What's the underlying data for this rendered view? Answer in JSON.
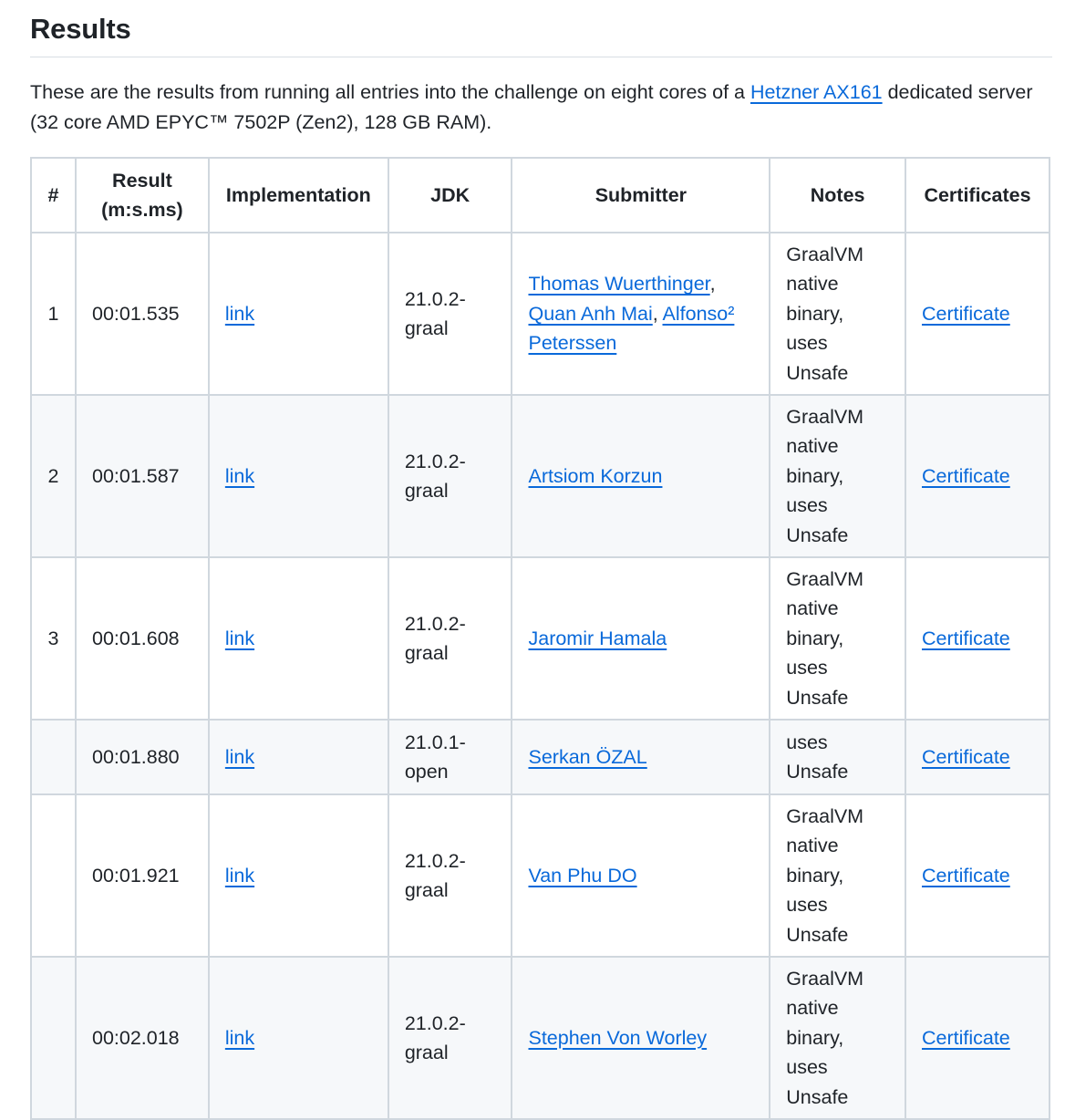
{
  "heading": "Results",
  "intro": {
    "before": "These are the results from running all entries into the challenge on eight cores of a ",
    "link": "Hetzner AX161",
    "after": " dedicated server (32 core AMD EPYC™ 7502P (Zen2), 128 GB RAM)."
  },
  "table": {
    "headers": [
      "#",
      "Result (m:s.ms)",
      "Implementation",
      "JDK",
      "Submitter",
      "Notes",
      "Certificates"
    ],
    "rows": [
      {
        "rank": "1",
        "result": "00:01.535",
        "impl": "link",
        "jdk": "21.0.2-graal",
        "submitters": [
          "Thomas Wuerthinger",
          "Quan Anh Mai",
          "Alfonso² Peterssen"
        ],
        "notes": "GraalVM native binary, uses Unsafe",
        "cert": "Certificate"
      },
      {
        "rank": "2",
        "result": "00:01.587",
        "impl": "link",
        "jdk": "21.0.2-graal",
        "submitters": [
          "Artsiom Korzun"
        ],
        "notes": "GraalVM native binary, uses Unsafe",
        "cert": "Certificate"
      },
      {
        "rank": "3",
        "result": "00:01.608",
        "impl": "link",
        "jdk": "21.0.2-graal",
        "submitters": [
          "Jaromir Hamala"
        ],
        "notes": "GraalVM native binary, uses Unsafe",
        "cert": "Certificate"
      },
      {
        "rank": "",
        "result": "00:01.880",
        "impl": "link",
        "jdk": "21.0.1-open",
        "submitters": [
          "Serkan ÖZAL"
        ],
        "notes": "uses Unsafe",
        "cert": "Certificate"
      },
      {
        "rank": "",
        "result": "00:01.921",
        "impl": "link",
        "jdk": "21.0.2-graal",
        "submitters": [
          "Van Phu DO"
        ],
        "notes": "GraalVM native binary, uses Unsafe",
        "cert": "Certificate"
      },
      {
        "rank": "",
        "result": "00:02.018",
        "impl": "link",
        "jdk": "21.0.2-graal",
        "submitters": [
          "Stephen Von Worley"
        ],
        "notes": "GraalVM native binary, uses Unsafe",
        "cert": "Certificate"
      }
    ]
  }
}
